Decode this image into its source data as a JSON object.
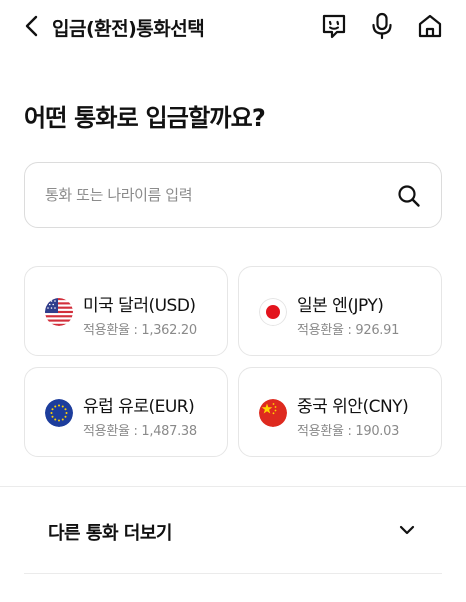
{
  "header": {
    "title": "입금(환전)통화선택",
    "back_icon": "chevron-left-icon",
    "chat_icon": "chatbot-face-icon",
    "mic_icon": "microphone-icon",
    "home_icon": "home-icon"
  },
  "page_title": "어떤 통화로 입금할까요?",
  "search": {
    "placeholder": "통화 또는 나라이름 입력",
    "value": "",
    "icon": "search-icon"
  },
  "currencies": [
    {
      "name": "미국 달러(USD)",
      "rate": "적용환율 : 1,362.20",
      "flag": "us-flag-icon"
    },
    {
      "name": "일본 엔(JPY)",
      "rate": "적용환율 : 926.91",
      "flag": "japan-flag-icon"
    },
    {
      "name": "유럽 유로(EUR)",
      "rate": "적용환율 : 1,487.38",
      "flag": "eu-flag-icon"
    },
    {
      "name": "중국 위안(CNY)",
      "rate": "적용환율 : 190.03",
      "flag": "china-flag-icon"
    }
  ],
  "more": {
    "label": "다른 통화 더보기",
    "icon": "chevron-down-icon"
  },
  "colors": {
    "text": "#111111",
    "subtext": "#8a8a8a",
    "border": "#e6e6e6"
  }
}
